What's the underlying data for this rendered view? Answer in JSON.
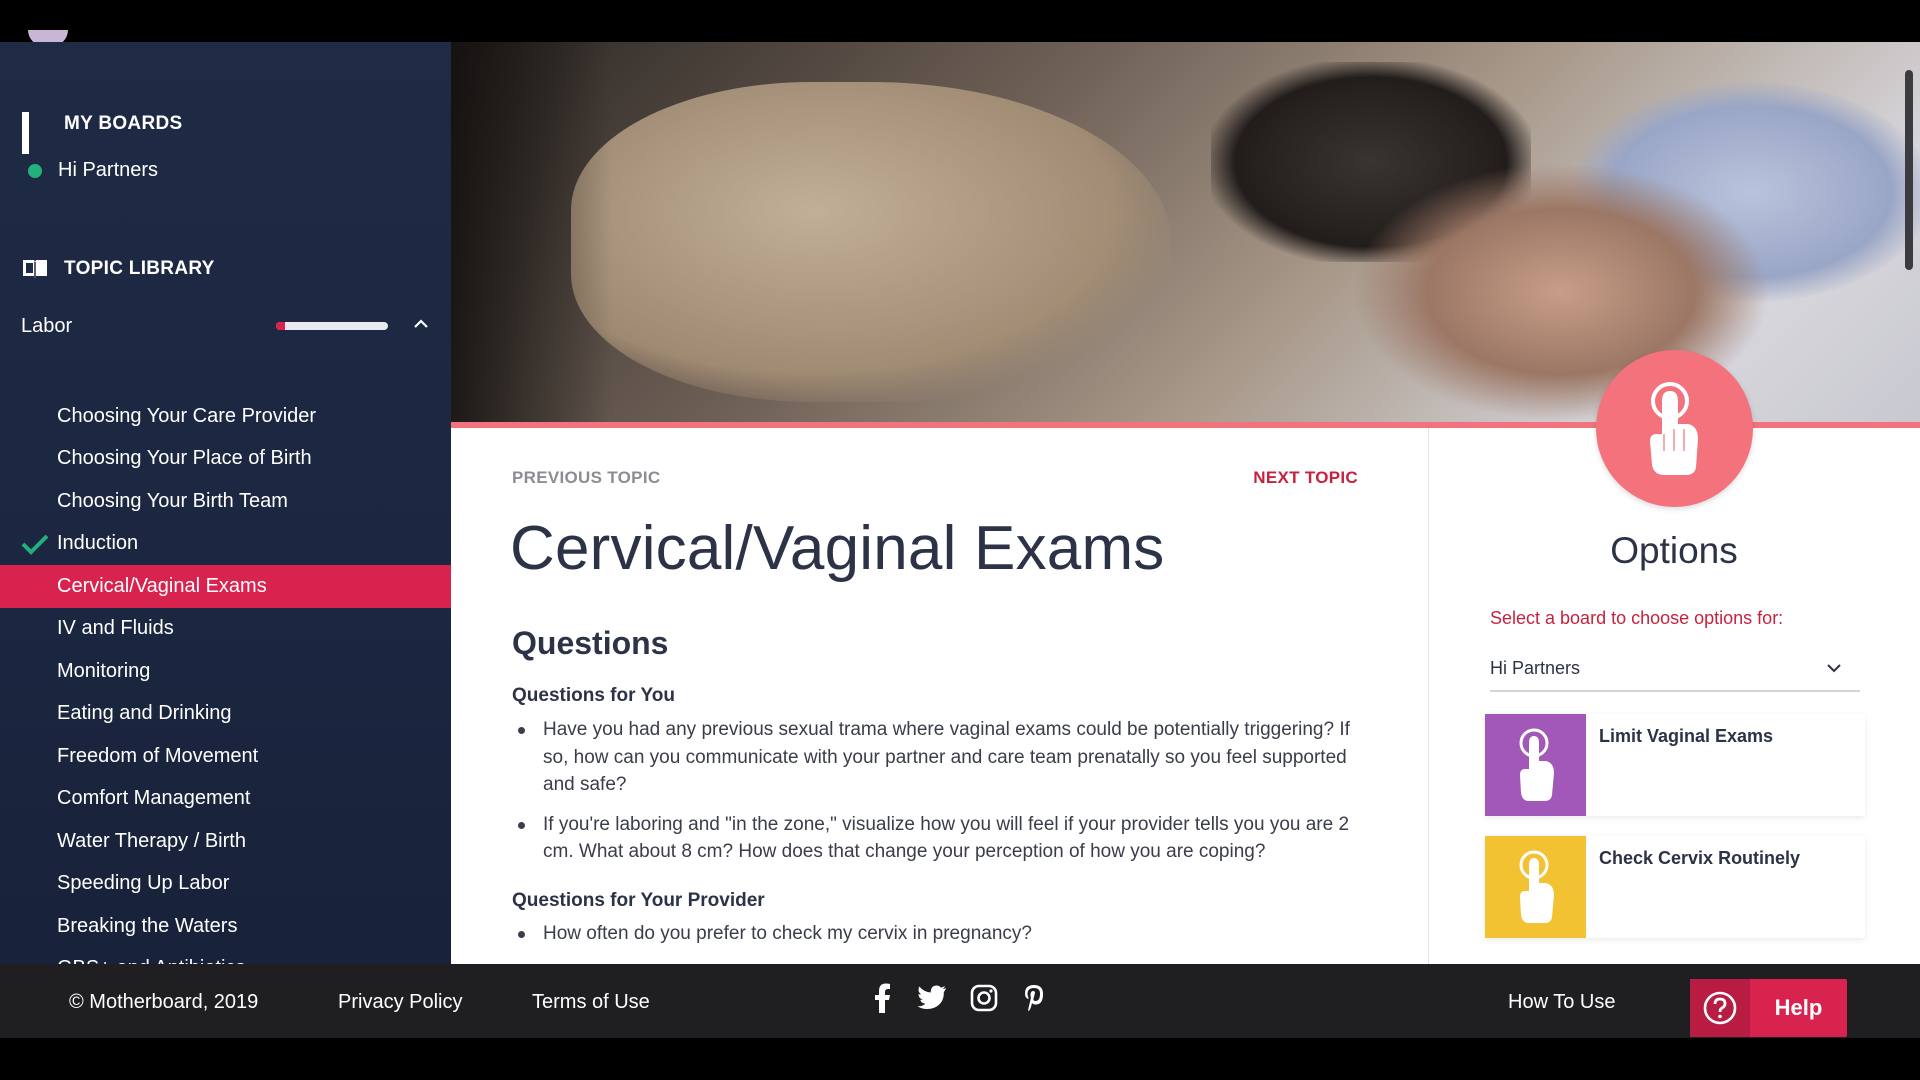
{
  "sidebar": {
    "my_boards_label": "MY BOARDS",
    "board_item": "Hi Partners",
    "topic_library_label": "TOPIC LIBRARY",
    "category_label": "Labor",
    "category_progress": 0.08,
    "topics": [
      {
        "label": "Choosing Your Care Provider",
        "state": "normal"
      },
      {
        "label": "Choosing Your Place of Birth",
        "state": "normal"
      },
      {
        "label": "Choosing Your Birth Team",
        "state": "normal"
      },
      {
        "label": "Induction",
        "state": "completed"
      },
      {
        "label": "Cervical/Vaginal Exams",
        "state": "active"
      },
      {
        "label": "IV and Fluids",
        "state": "normal"
      },
      {
        "label": "Monitoring",
        "state": "normal"
      },
      {
        "label": "Eating and Drinking",
        "state": "normal"
      },
      {
        "label": "Freedom of Movement",
        "state": "normal"
      },
      {
        "label": "Comfort Management",
        "state": "normal"
      },
      {
        "label": "Water Therapy / Birth",
        "state": "normal"
      },
      {
        "label": "Speeding Up Labor",
        "state": "normal"
      },
      {
        "label": "Breaking the Waters",
        "state": "normal"
      },
      {
        "label": "GBS+ and Antibiotics",
        "state": "normal"
      }
    ]
  },
  "main": {
    "prev_topic": "PREVIOUS TOPIC",
    "next_topic": "NEXT TOPIC",
    "title": "Cervical/Vaginal Exams",
    "section_title": "Questions",
    "questions_for_you_title": "Questions for You",
    "questions_for_you": [
      "Have you had any previous sexual trama where vaginal exams could be potentially triggering? If so, how can you communicate with your partner and care team prenatally so you feel supported and safe?",
      "If you're laboring and \"in the zone,\" visualize how you will feel if your provider tells you you are 2 cm. What about 8 cm? How does that change your perception of how you are coping?"
    ],
    "questions_for_provider_title": "Questions for Your Provider",
    "questions_for_provider": [
      "How often do you prefer to check my cervix in pregnancy?"
    ]
  },
  "options": {
    "title": "Options",
    "prompt": "Select a board to choose options for:",
    "selected_board": "Hi Partners",
    "cards": [
      {
        "label": "Limit Vaginal Exams",
        "color": "#a158b8"
      },
      {
        "label": "Check Cervix Routinely",
        "color": "#f3c233"
      }
    ]
  },
  "footer": {
    "copyright": "© Motherboard, 2019",
    "privacy": "Privacy Policy",
    "terms": "Terms of Use",
    "social_icons": [
      "facebook-icon",
      "twitter-icon",
      "instagram-icon",
      "pinterest-icon"
    ],
    "how_to_use": "How To Use",
    "help": "Help"
  },
  "colors": {
    "accent": "#d8234f",
    "sidebar_bg": "#1f2a45",
    "option_circle": "#f3727b"
  }
}
